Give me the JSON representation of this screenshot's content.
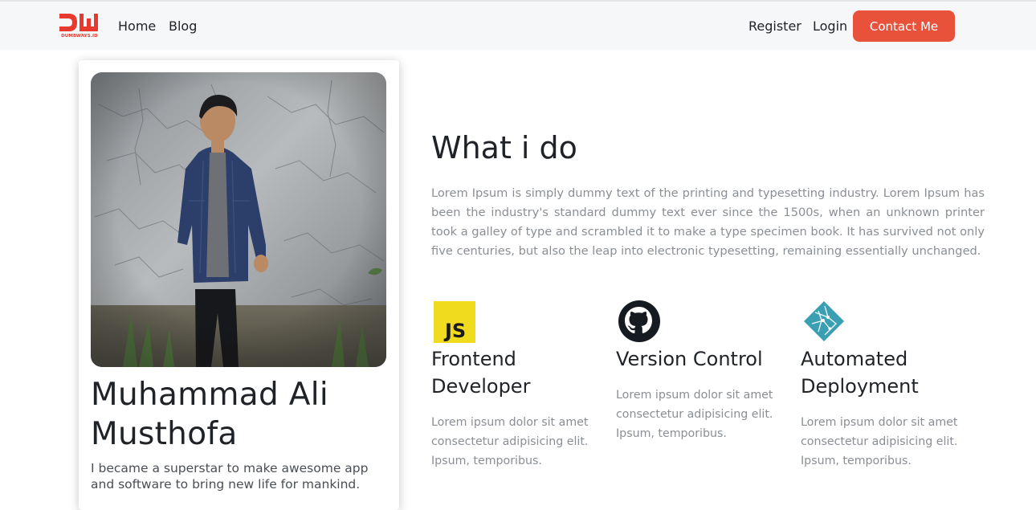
{
  "brand": {
    "logo_mark": "DW",
    "logo_caption": "DUMBWAYS.ID",
    "accent_color": "#e8523a"
  },
  "nav": {
    "links": [
      "Home",
      "Blog"
    ],
    "right_links": [
      "Register",
      "Login"
    ],
    "cta_label": "Contact Me"
  },
  "profile": {
    "photo_icon": "profile-photo",
    "name": "Muhammad Ali Musthofa",
    "bio": "I became a superstar to make awesome app and software to bring new life for mankind."
  },
  "main": {
    "title": "What i do",
    "description": "Lorem Ipsum is simply dummy text of the printing and typesetting industry. Lorem Ipsum has been the industry's standard dummy text ever since the 1500s, when an unknown printer took a galley of type and scrambled it to make a type specimen book. It has survived not only five centuries, but also the leap into electronic typesetting, remaining essentially unchanged."
  },
  "services": [
    {
      "icon": "javascript-icon",
      "title": "Frontend Developer",
      "description": "Lorem ipsum dolor sit amet consectetur adipisicing elit. Ipsum, temporibus."
    },
    {
      "icon": "github-icon",
      "title": "Version Control",
      "description": "Lorem ipsum dolor sit amet consectetur adipisicing elit. Ipsum, temporibus."
    },
    {
      "icon": "netlify-icon",
      "title": "Automated Deployment",
      "description": "Lorem ipsum dolor sit amet consectetur adipisicing elit. Ipsum, temporibus."
    }
  ]
}
